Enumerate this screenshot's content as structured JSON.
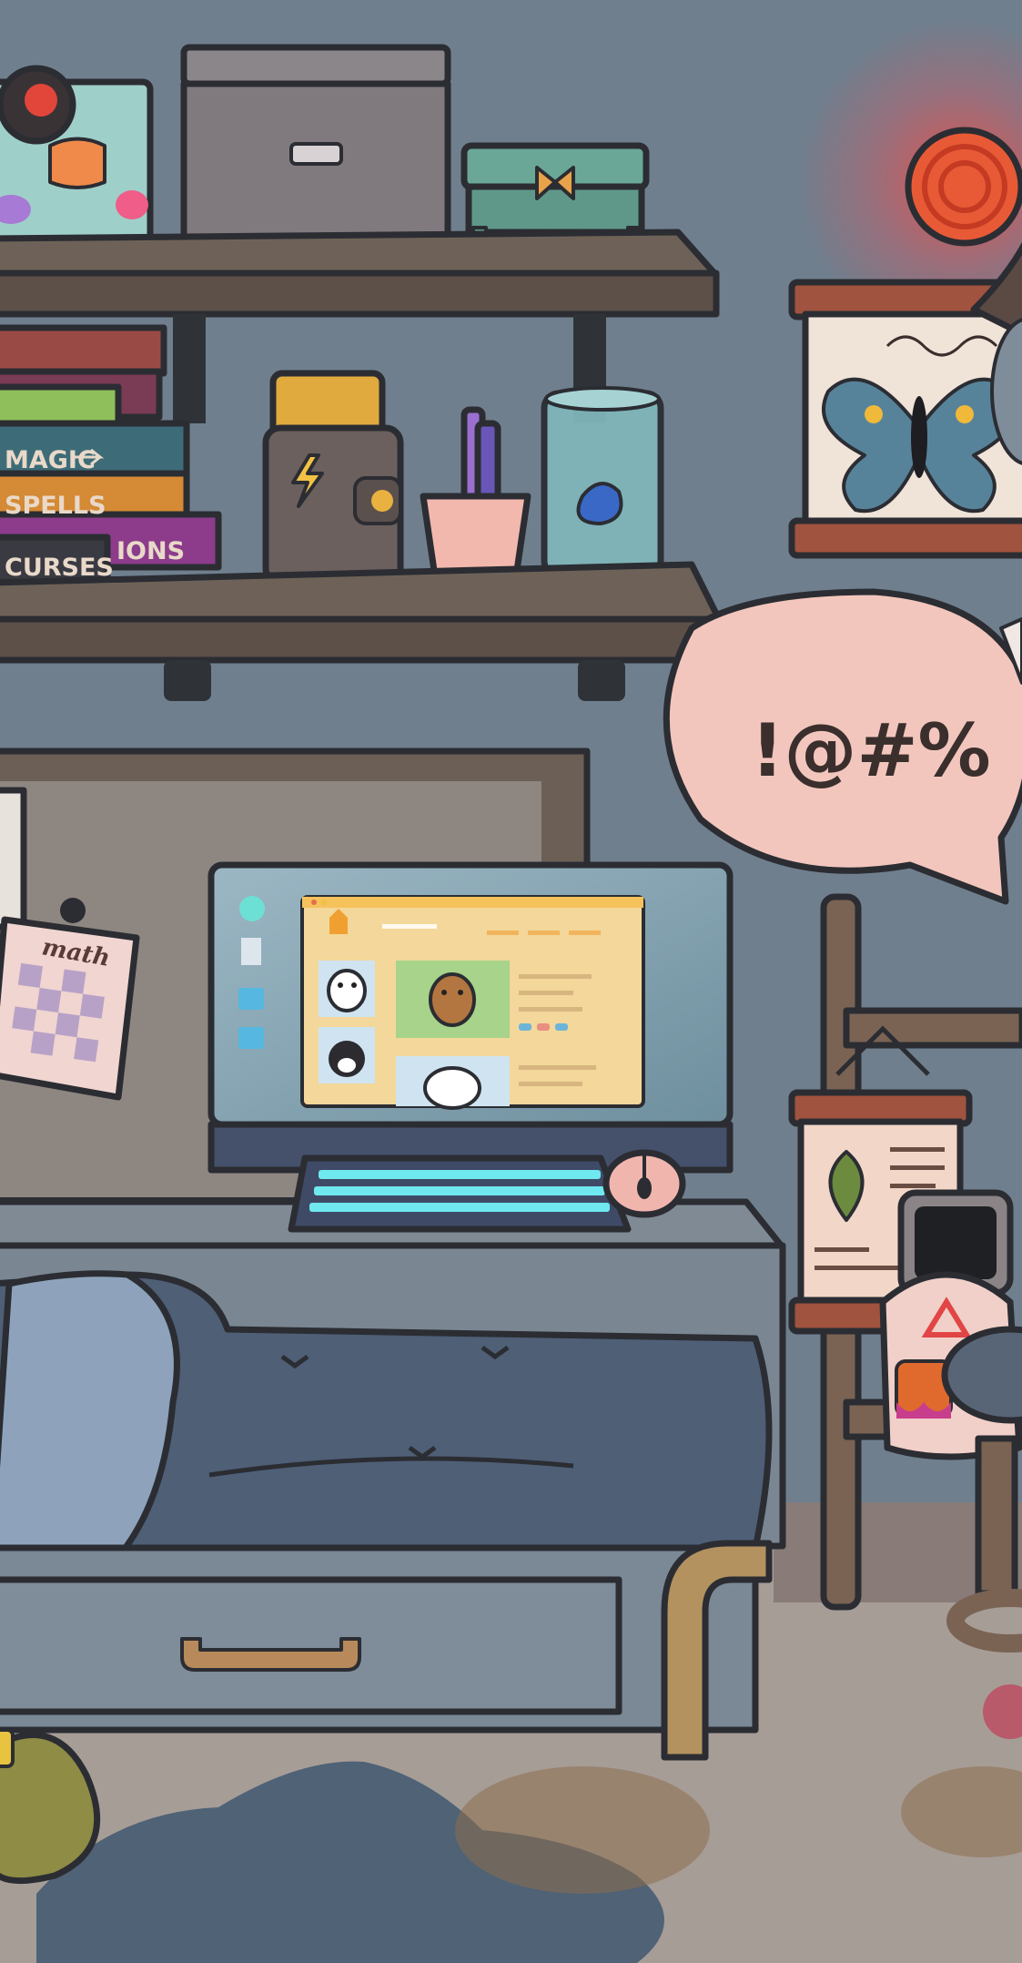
{
  "scene": {
    "wall_color": "#6f7f8e",
    "floor_color": "#a79d97"
  },
  "books": {
    "magic": "MAGIC",
    "spells": "SPELLS",
    "curses": "CURSES",
    "potions_partial": "IONS"
  },
  "speech_bubble": {
    "text": "!@#%"
  },
  "pinned_note": {
    "title": "math"
  },
  "computer": {
    "screen_app": "pet adoption browser",
    "icons": [
      "desktop-app-icon",
      "document-icon",
      "folder-icon",
      "folder-icon"
    ]
  },
  "icons": {
    "lightning": "lightning-icon",
    "butterfly": "butterfly-icon",
    "leaf": "leaf-icon",
    "warning": "warning-triangle-icon"
  }
}
